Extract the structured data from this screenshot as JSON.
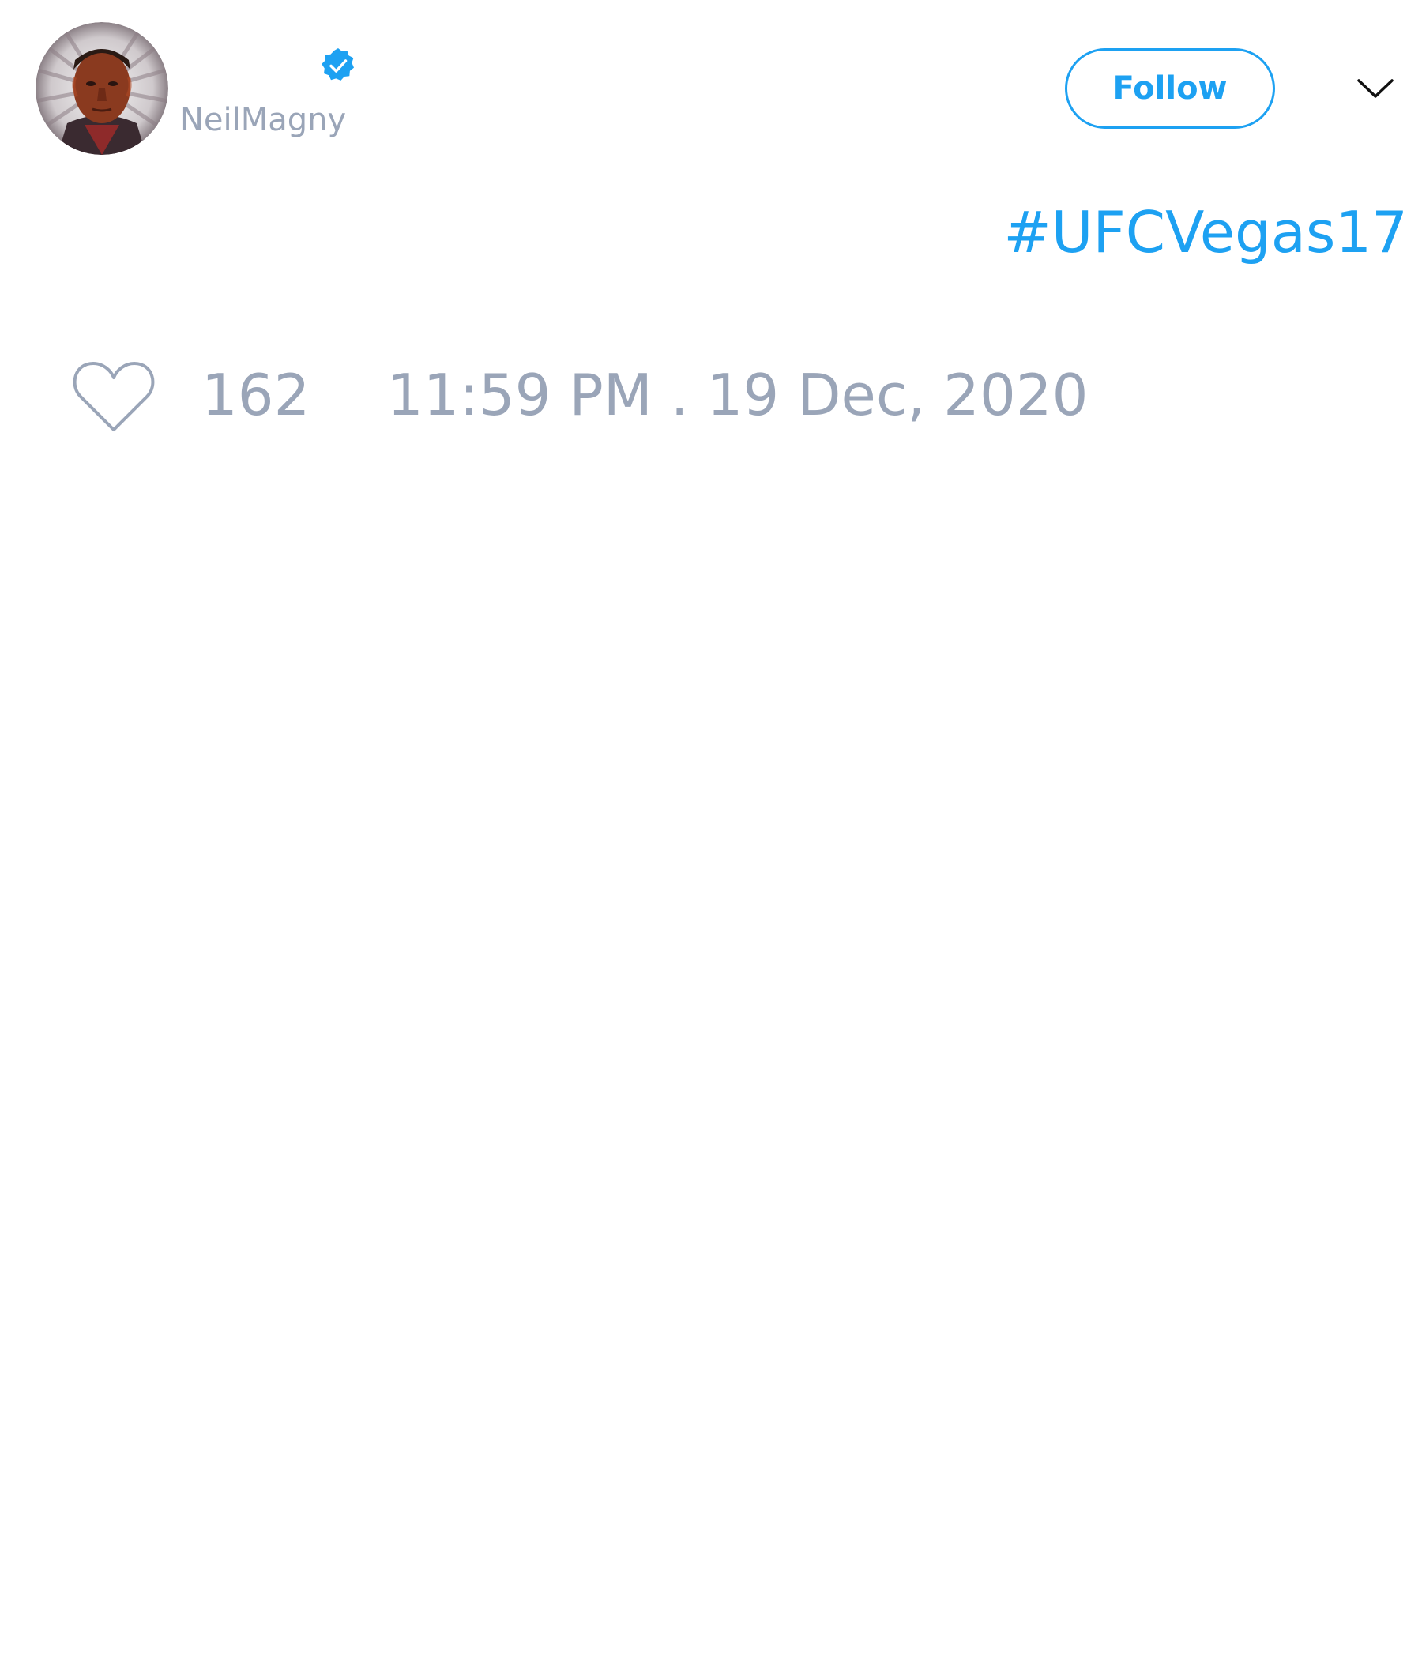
{
  "author": {
    "handle": "NeilMagny",
    "verified": true,
    "avatar_icon": "profile-photo"
  },
  "actions": {
    "follow_label": "Follow",
    "menu_icon": "chevron-down-icon"
  },
  "tweet": {
    "text": "#UFCVegas17",
    "like_icon": "heart-outline-icon",
    "like_count": "162",
    "timestamp": "11:59 PM . 19 Dec, 2020"
  },
  "colors": {
    "accent": "#1da1f2",
    "muted_text": "#9aa5b8",
    "background": "#ffffff"
  }
}
